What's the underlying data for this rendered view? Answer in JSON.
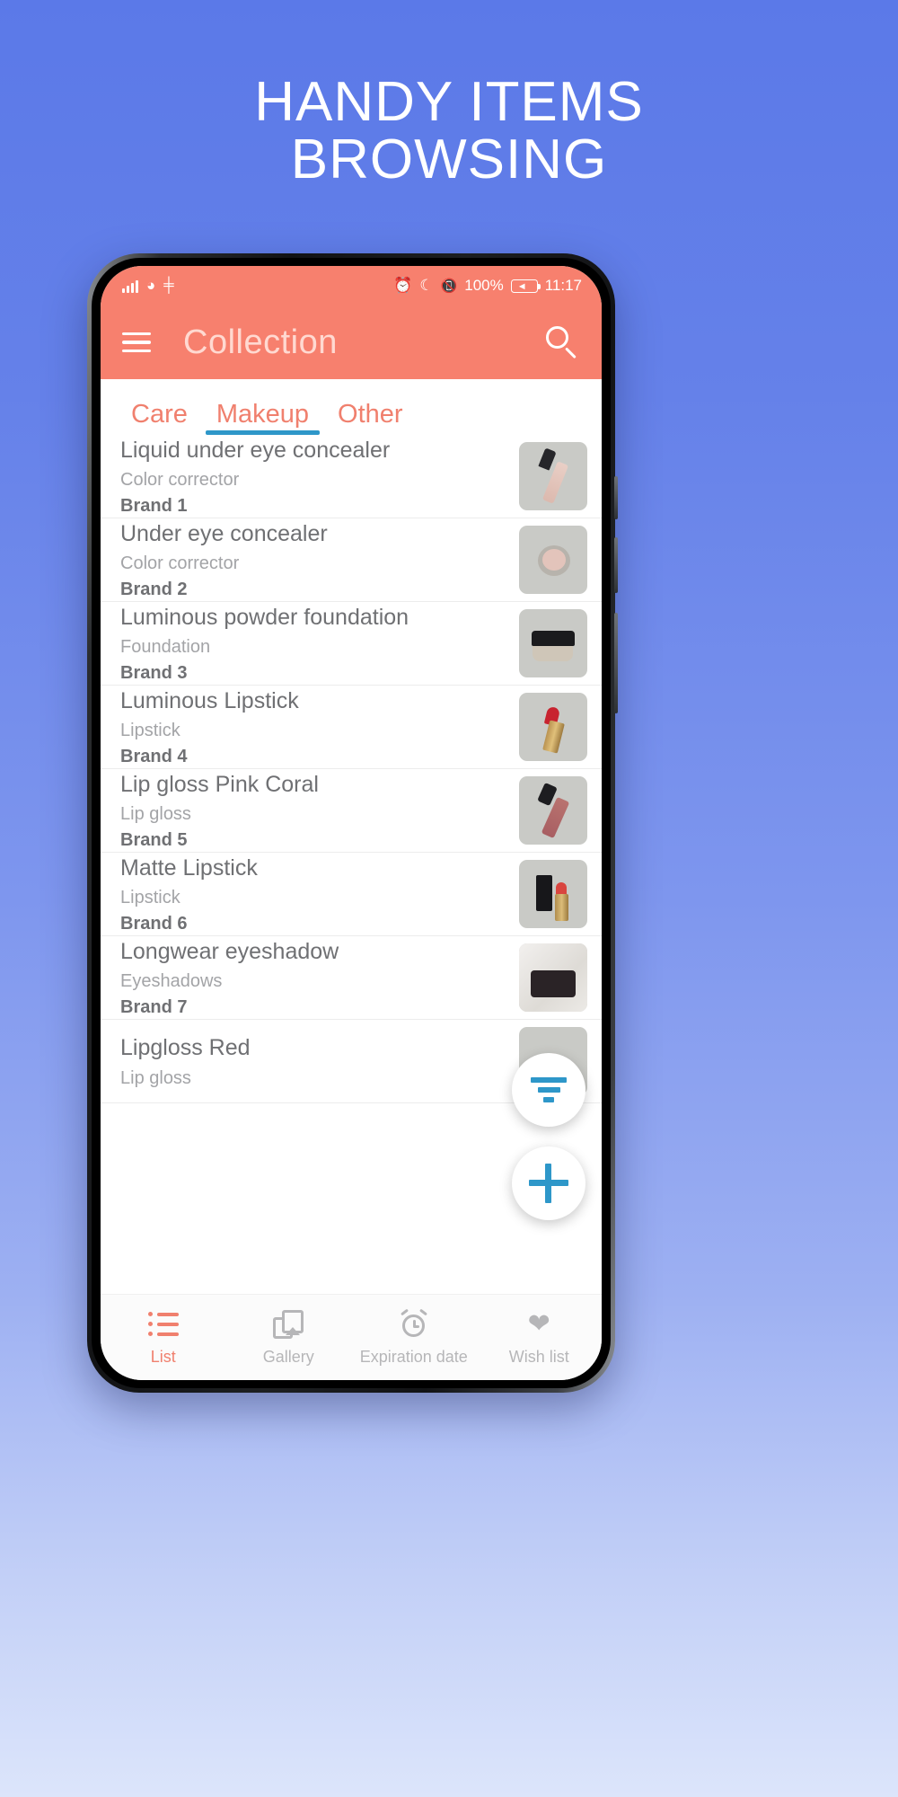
{
  "headline": {
    "line1": "HANDY ITEMS",
    "line2": "BROWSING"
  },
  "statusbar": {
    "signal_icon": "signal-icon",
    "wifi_icon": "wifi-icon",
    "nfc_icon": "nfc-icon",
    "nfc_label": "N",
    "alarm_icon": "alarm-icon",
    "dnd_icon": "moon-icon",
    "vibrate_icon": "vibrate-icon",
    "battery_percent": "100%",
    "battery_icon": "battery-charging-icon",
    "time": "11:17"
  },
  "appbar": {
    "menu_icon": "hamburger-menu-icon",
    "title": "Collection",
    "search_icon": "search-icon"
  },
  "tabs": [
    {
      "label": "Care",
      "active": false
    },
    {
      "label": "Makeup",
      "active": true
    },
    {
      "label": "Other",
      "active": false
    }
  ],
  "items": [
    {
      "title": "Liquid under eye concealer",
      "category": "Color corrector",
      "brand": "Brand 1",
      "thumb": "lipgloss-tube-nude-photo"
    },
    {
      "title": "Under eye concealer",
      "category": "Color corrector",
      "brand": "Brand 2",
      "thumb": "concealer-pot-photo"
    },
    {
      "title": "Luminous powder foundation",
      "category": "Foundation",
      "brand": "Brand 3",
      "thumb": "powder-jar-photo"
    },
    {
      "title": "Luminous Lipstick",
      "category": "Lipstick",
      "brand": "Brand 4",
      "thumb": "red-gold-lipstick-photo"
    },
    {
      "title": "Lip gloss Pink Coral",
      "category": "Lip gloss",
      "brand": "Brand 5",
      "thumb": "pink-lipgloss-tube-photo"
    },
    {
      "title": "Matte Lipstick",
      "category": "Lipstick",
      "brand": "Brand 6",
      "thumb": "black-cap-lipstick-photo"
    },
    {
      "title": "Longwear eyeshadow",
      "category": "Eyeshadows",
      "brand": "Brand 7",
      "thumb": "eyeshadow-pan-photo"
    },
    {
      "title": "Lipgloss Red",
      "category": "Lip gloss",
      "brand": "",
      "thumb": "red-lipgloss-photo"
    }
  ],
  "fabs": {
    "filter_icon": "filter-icon",
    "add_icon": "plus-icon"
  },
  "bottomnav": [
    {
      "label": "List",
      "icon": "list-icon",
      "active": true
    },
    {
      "label": "Gallery",
      "icon": "gallery-icon",
      "active": false
    },
    {
      "label": "Expiration date",
      "icon": "alarm-clock-icon",
      "active": false
    },
    {
      "label": "Wish list",
      "icon": "heart-icon",
      "active": false
    }
  ],
  "colors": {
    "brand_coral": "#f7806e",
    "accent_blue": "#2e97c9",
    "background_blue": "#5b79e8"
  }
}
